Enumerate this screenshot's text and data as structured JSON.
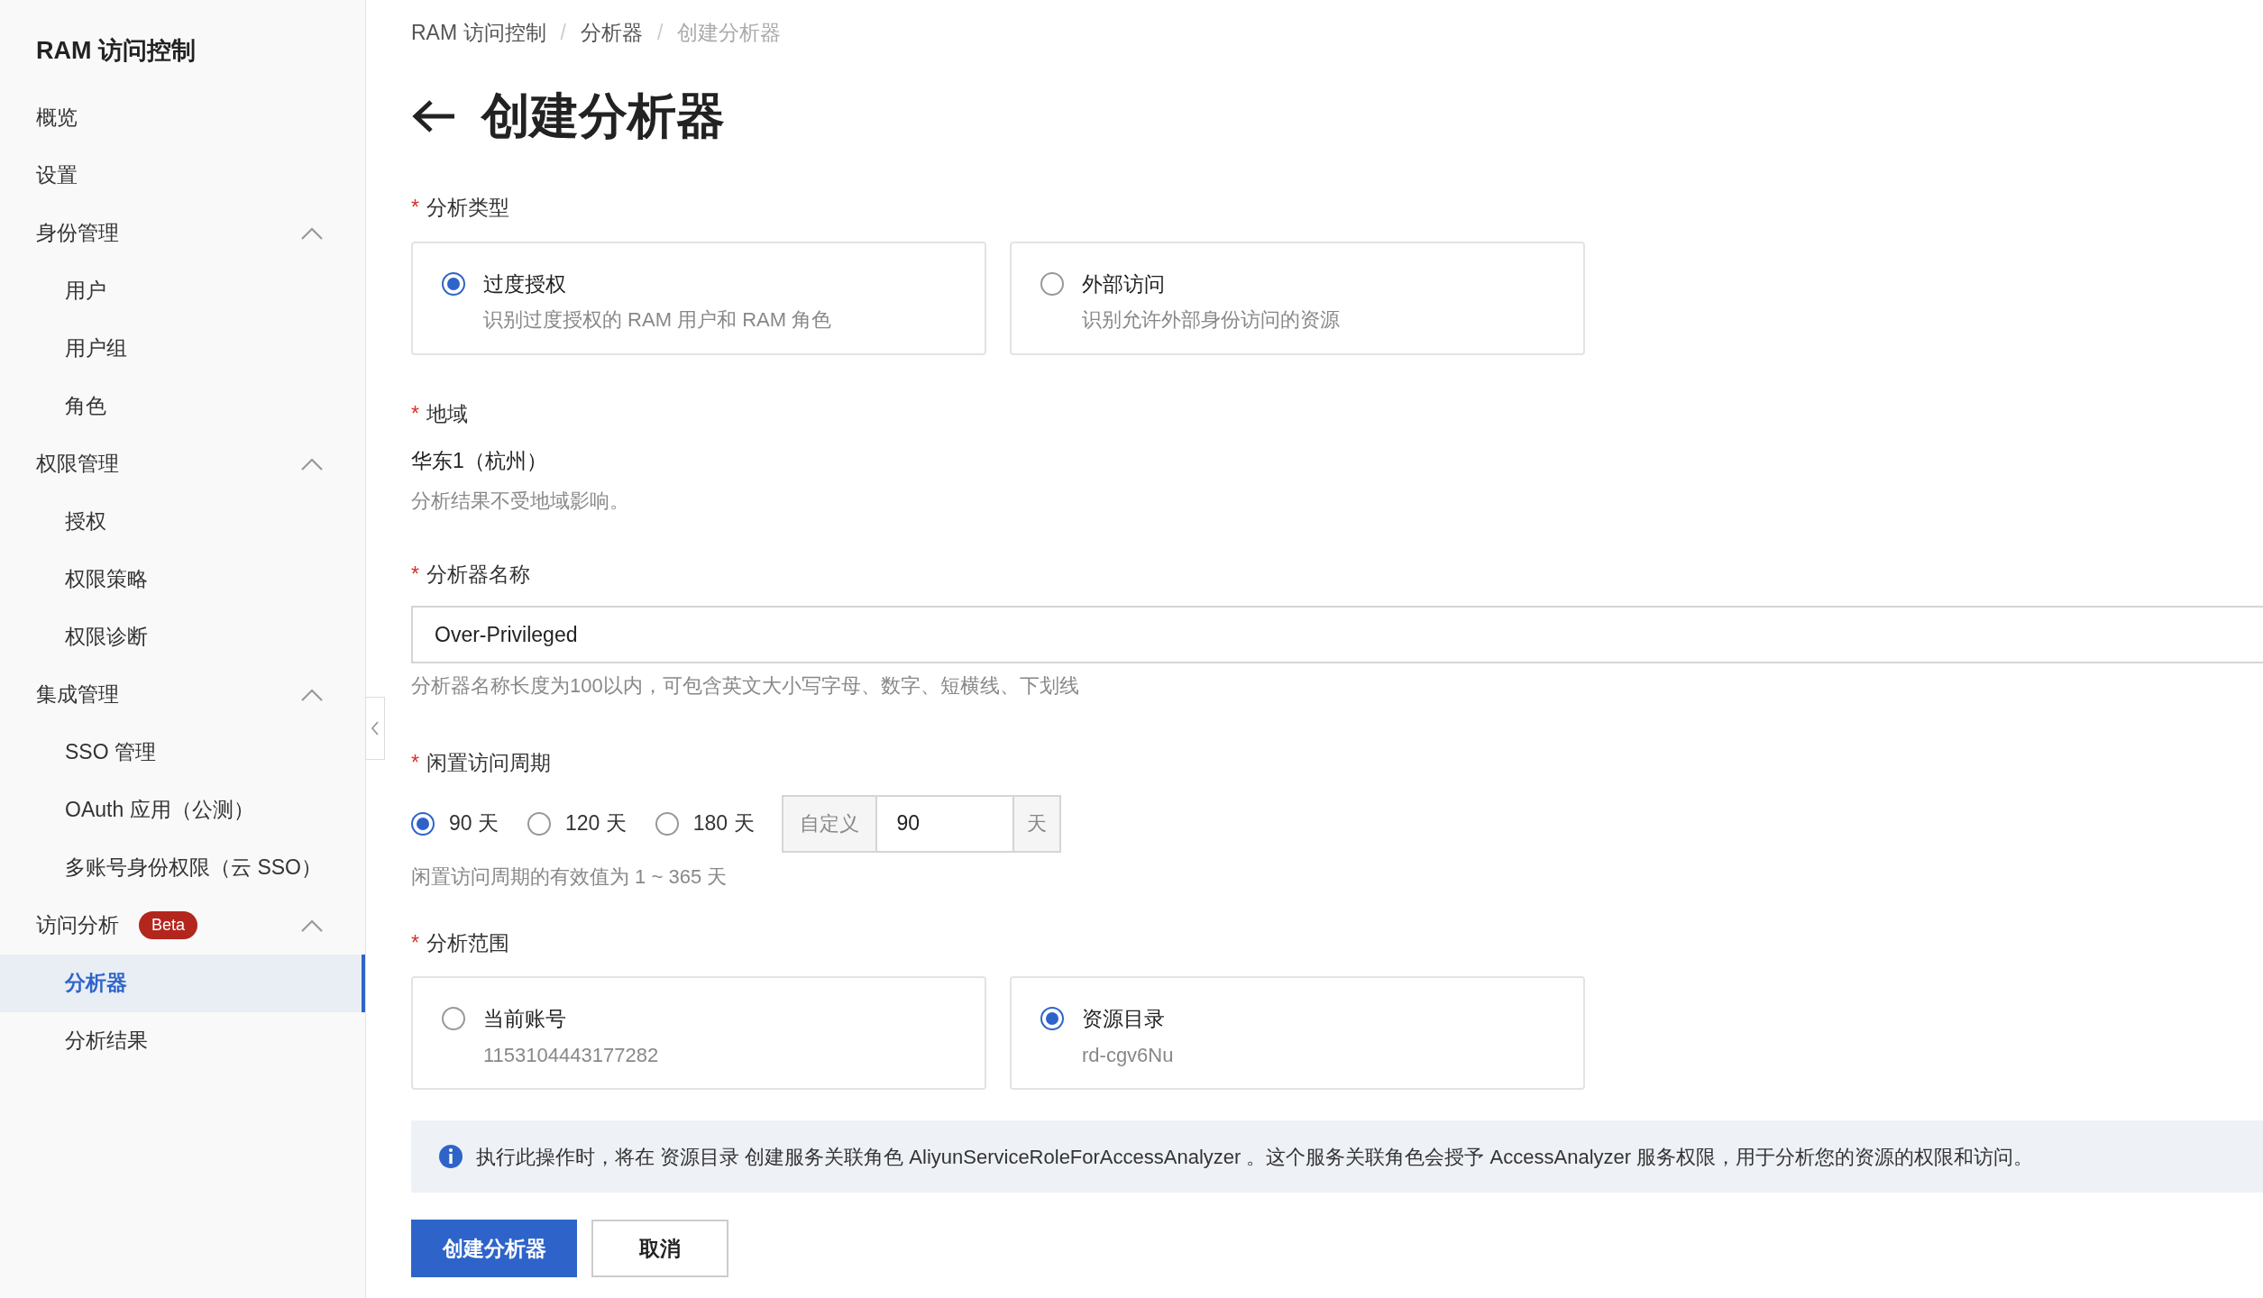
{
  "sidebar": {
    "title": "RAM 访问控制",
    "items": [
      {
        "label": "概览",
        "selected": false
      },
      {
        "label": "设置",
        "selected": false
      },
      {
        "label": "身份管理",
        "expanded": true,
        "children": [
          {
            "label": "用户",
            "selected": false
          },
          {
            "label": "用户组",
            "selected": false
          },
          {
            "label": "角色",
            "selected": false
          }
        ]
      },
      {
        "label": "权限管理",
        "expanded": true,
        "children": [
          {
            "label": "授权",
            "selected": false
          },
          {
            "label": "权限策略",
            "selected": false
          },
          {
            "label": "权限诊断",
            "selected": false
          }
        ]
      },
      {
        "label": "集成管理",
        "expanded": true,
        "children": [
          {
            "label": "SSO 管理",
            "selected": false
          },
          {
            "label": "OAuth 应用（公测）",
            "selected": false
          },
          {
            "label": "多账号身份权限（云 SSO）",
            "selected": false
          }
        ]
      },
      {
        "label": "访问分析",
        "badge": "Beta",
        "expanded": true,
        "children": [
          {
            "label": "分析器",
            "selected": true
          },
          {
            "label": "分析结果",
            "selected": false
          }
        ]
      }
    ]
  },
  "breadcrumb": [
    {
      "label": "RAM 访问控制"
    },
    {
      "separator": "/",
      "label": "分析器"
    },
    {
      "separator": "/",
      "label": "创建分析器"
    }
  ],
  "page_title": "创建分析器",
  "form": {
    "analysis_type": {
      "label": "分析类型",
      "required_mark": "*",
      "options": [
        {
          "title": "过度授权",
          "description": "识别过度授权的 RAM 用户和 RAM 角色",
          "selected": true
        },
        {
          "title": "外部访问",
          "description": "识别允许外部身份访问的资源",
          "selected": false
        }
      ]
    },
    "region": {
      "label": "地域",
      "required_mark": "*",
      "value": "华东1（杭州）",
      "hint": "分析结果不受地域影响。"
    },
    "analyzer_name": {
      "label": "分析器名称",
      "required_mark": "*",
      "value": "Over-Privileged",
      "hint": "分析器名称长度为100以内，可包含英文大小写字母、数字、短横线、下划线"
    },
    "idle_period": {
      "label": "闲置访问周期",
      "required_mark": "*",
      "options": [
        {
          "label": "90 天",
          "selected": true
        },
        {
          "label": "120 天",
          "selected": false
        },
        {
          "label": "180 天",
          "selected": false
        }
      ],
      "custom_prefix": "自定义",
      "custom_value": "90",
      "custom_suffix": "天",
      "hint": "闲置访问周期的有效值为 1 ~ 365 天"
    },
    "scope": {
      "label": "分析范围",
      "required_mark": "*",
      "options": [
        {
          "title": "当前账号",
          "description": "1153104443177282",
          "selected": false
        },
        {
          "title": "资源目录",
          "description": "rd-cgv6Nu",
          "selected": true
        }
      ]
    }
  },
  "notice": "执行此操作时，将在 资源目录 创建服务关联角色 AliyunServiceRoleForAccessAnalyzer 。这个服务关联角色会授予 AccessAnalyzer 服务权限，用于分析您的资源的权限和访问。",
  "buttons": [
    {
      "label": "创建分析器",
      "kind": "primary"
    },
    {
      "label": "取消",
      "kind": "secondary"
    }
  ]
}
